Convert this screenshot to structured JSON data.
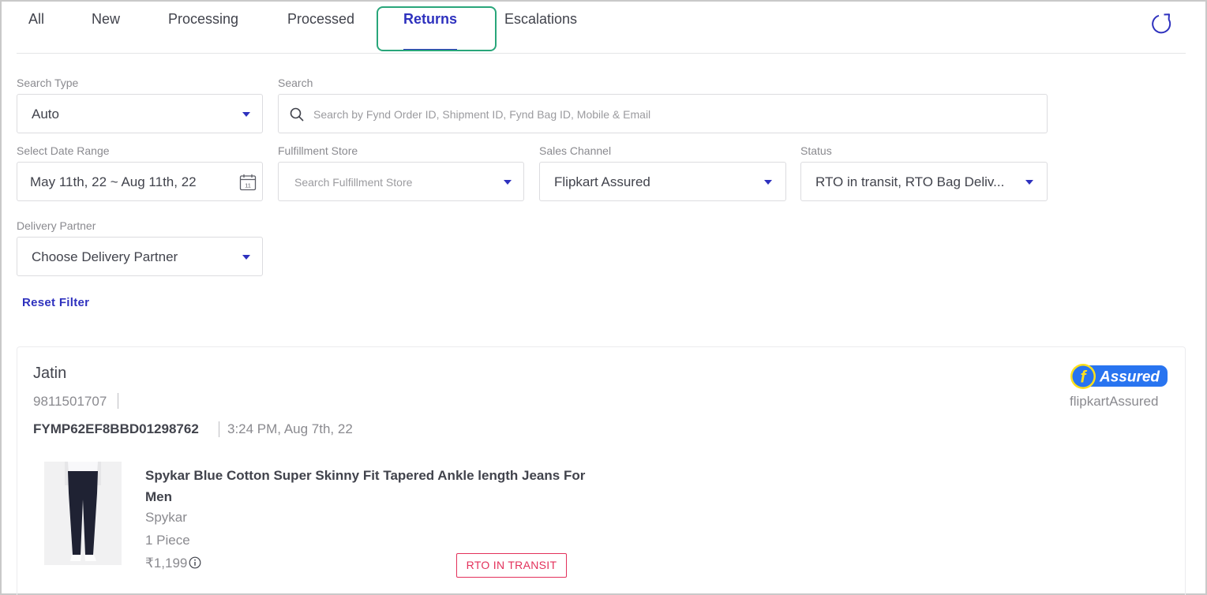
{
  "tabs": [
    {
      "label": "All"
    },
    {
      "label": "New"
    },
    {
      "label": "Processing"
    },
    {
      "label": "Processed"
    },
    {
      "label": "Returns",
      "active": true
    },
    {
      "label": "Escalations"
    }
  ],
  "filters": {
    "search_type": {
      "label": "Search Type",
      "value": "Auto"
    },
    "search": {
      "label": "Search",
      "placeholder": "Search by Fynd Order ID, Shipment ID, Fynd Bag ID, Mobile & Email"
    },
    "date_range": {
      "label": "Select Date Range",
      "value": "May 11th, 22 ~ Aug 11th, 22",
      "calendar_day": "11"
    },
    "fulfillment_store": {
      "label": "Fulfillment Store",
      "placeholder": "Search Fulfillment Store"
    },
    "sales_channel": {
      "label": "Sales Channel",
      "value": "Flipkart Assured"
    },
    "status": {
      "label": "Status",
      "value": "RTO in transit, RTO Bag Deliv..."
    },
    "delivery_partner": {
      "label": "Delivery Partner",
      "value": "Choose Delivery Partner"
    },
    "reset_label": "Reset Filter"
  },
  "order": {
    "customer_name": "Jatin",
    "phone": "9811501707",
    "order_id": "FYMP62EF8BBD01298762",
    "time": "3:24 PM, Aug 7th, 22",
    "channel": {
      "badge_text": "Assured",
      "badge_logo_letter": "f",
      "name": "flipkartAssured"
    },
    "product": {
      "title": "Spykar Blue Cotton Super Skinny Fit Tapered Ankle length Jeans For Men",
      "brand": "Spykar",
      "quantity": "1 Piece",
      "price": "₹1,199",
      "status": "RTO IN TRANSIT"
    }
  },
  "colors": {
    "accent": "#2e31be",
    "highlight": "#29a67a",
    "status": "#e3315b",
    "flipkart_blue": "#2874f0",
    "flipkart_yellow": "#ffe11b"
  },
  "icons": [
    "refresh-icon",
    "search-icon",
    "calendar-icon",
    "info-icon",
    "chevron-down-icon"
  ]
}
